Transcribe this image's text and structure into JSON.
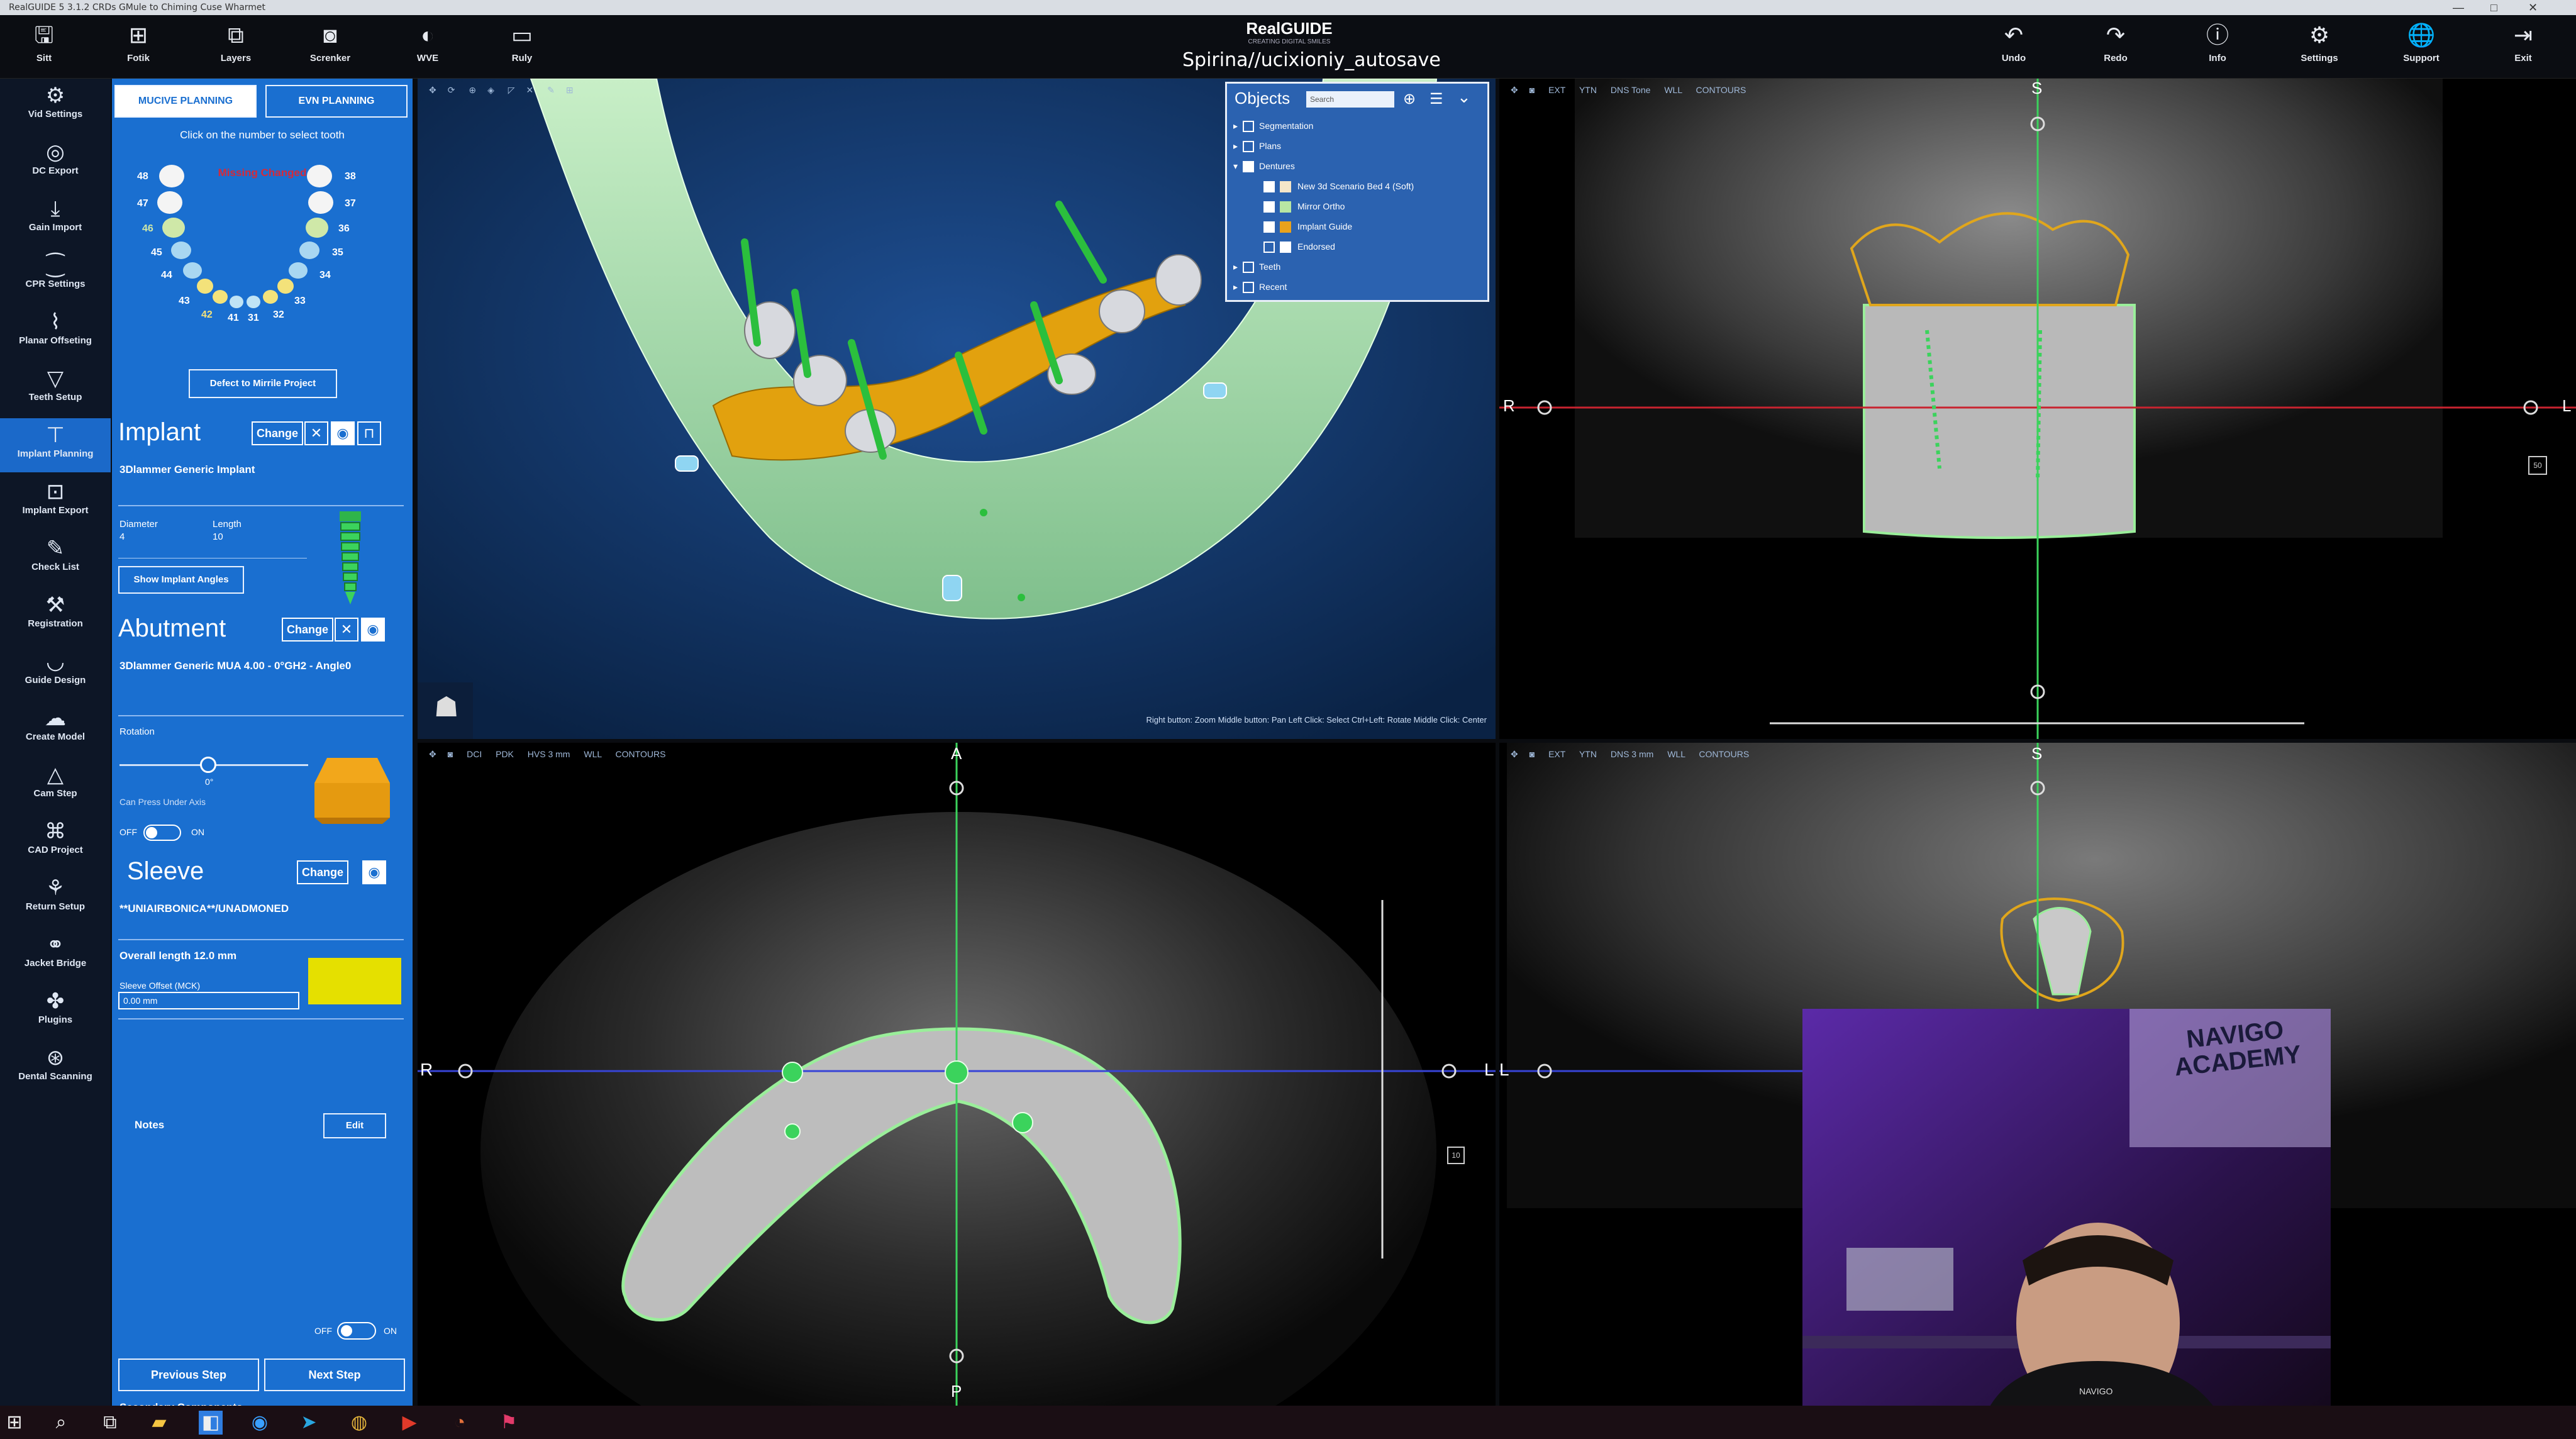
{
  "window": {
    "title": "RealGUIDE 5 3.1.2 CRDs GMule to Chiming Cuse Wharmet",
    "controls": [
      "—",
      "□",
      "✕"
    ]
  },
  "toolbar": {
    "left": [
      {
        "label": "Sitt",
        "icon": "save-icon"
      },
      {
        "label": "Fotik",
        "icon": "export-icon"
      },
      {
        "label": "Layers",
        "icon": "layers-icon"
      },
      {
        "label": "Screnker",
        "icon": "camera-icon"
      },
      {
        "label": "WVE",
        "icon": "contrast-icon"
      },
      {
        "label": "Ruly",
        "icon": "ruler-icon"
      }
    ],
    "brand": "RealGUIDE",
    "brand_sub": "CREATING DIGITAL SMILES",
    "file_name": "Spirina//ucixioniy_autosave",
    "right": [
      {
        "label": "Undo",
        "icon": "undo-icon"
      },
      {
        "label": "Redo",
        "icon": "redo-icon"
      },
      {
        "label": "Info",
        "icon": "info-icon"
      },
      {
        "label": "Settings",
        "icon": "gear-icon"
      },
      {
        "label": "Support",
        "icon": "globe-icon"
      },
      {
        "label": "Exit",
        "icon": "exit-icon"
      }
    ]
  },
  "sidebar": {
    "items": [
      {
        "label": "Vid Settings",
        "icon": "sliders-icon"
      },
      {
        "label": "DC Export",
        "icon": "target-icon"
      },
      {
        "label": "Gain Import",
        "icon": "import-icon"
      },
      {
        "label": "CPR Settings",
        "icon": "curve-icon"
      },
      {
        "label": "Planar Offseting",
        "icon": "planar-icon"
      },
      {
        "label": "Teeth Setup",
        "icon": "tooth-icon"
      },
      {
        "label": "Implant Planning",
        "icon": "implant-icon",
        "active": true
      },
      {
        "label": "Implant Export",
        "icon": "implant-export-icon"
      },
      {
        "label": "Check List",
        "icon": "checklist-icon"
      },
      {
        "label": "Registration",
        "icon": "wrench-icon"
      },
      {
        "label": "Guide Design",
        "icon": "guide-icon"
      },
      {
        "label": "Create Model",
        "icon": "model-icon"
      },
      {
        "label": "Cam Step",
        "icon": "cam-icon"
      },
      {
        "label": "CAD Project",
        "icon": "cad-icon"
      },
      {
        "label": "Return Setup",
        "icon": "return-icon"
      },
      {
        "label": "Jacket Bridge",
        "icon": "bridge-icon"
      },
      {
        "label": "Plugins",
        "icon": "puzzle-icon"
      },
      {
        "label": "Dental Scanning",
        "icon": "scan-icon"
      }
    ]
  },
  "panel": {
    "tabs": [
      "MUCIVE PLANNING",
      "EVN PLANNING"
    ],
    "arch_caption": "Click on the number to select tooth",
    "arch_warning": "Missing Changed",
    "tooth_numbers": [
      "48",
      "47",
      "46",
      "45",
      "44",
      "43",
      "42",
      "41",
      "31",
      "32",
      "33",
      "34",
      "35",
      "36",
      "37",
      "38"
    ],
    "defect_button": "Defect to Mirrile Project",
    "implant": {
      "title": "Implant",
      "change_label": "Change",
      "name": "3Dlammer Generic Implant",
      "diameter_label": "Diameter",
      "diameter_value": "4",
      "length_label": "Length",
      "length_value": "10",
      "show_angles": "Show Implant Angles"
    },
    "abutment": {
      "title": "Abutment",
      "change_label": "Change",
      "name": "3Dlammer Generic MUA 4.00 - 0°GH2 - Angle0",
      "rotation_label": "Rotation",
      "rotation_value": "0°",
      "rotate_axis_label": "Can Press Under Axis",
      "toggle_off": "OFF",
      "toggle_on": "ON"
    },
    "sleeve": {
      "title": "Sleeve",
      "change_label": "Change",
      "name": "**UNIAIRBONICA**/UNADMONED",
      "length_label": "Overall length 12.0 mm",
      "offset_label": "Sleeve Offset (MCK)",
      "offset_value": "0.00 mm",
      "notes_label": "Notes",
      "edit_label": "Edit"
    },
    "secondary_label": "Secondary Components",
    "secondary_off": "OFF",
    "secondary_on": "ON",
    "prev_button": "Previous Step",
    "next_button": "Next Step"
  },
  "view3d": {
    "objects_title": "Objects",
    "objects_search": "Search",
    "objects": [
      {
        "label": "Segmentation",
        "level": 0
      },
      {
        "label": "Plans",
        "level": 0
      },
      {
        "label": "Dentures",
        "level": 0,
        "open": true
      },
      {
        "label": "New 3d Scenario Bed 4 (Soft)",
        "level": 1,
        "color": "#f4e6c9"
      },
      {
        "label": "Mirror Ortho",
        "level": 1,
        "color": "#b8e6a3"
      },
      {
        "label": "Implant Guide",
        "level": 1,
        "color": "#e9a21c"
      },
      {
        "label": "Endorsed",
        "level": 1,
        "color": "#ffffff"
      },
      {
        "label": "Teeth",
        "level": 0
      },
      {
        "label": "Recent",
        "level": 0
      }
    ],
    "status": "Right button: Zoom   Middle button: Pan   Left Click: Select   Ctrl+Left: Rotate   Middle Click: Center"
  },
  "coronal": {
    "toolbar": [
      "EXT",
      "YTN",
      "DNS Tone",
      "WLL",
      "CONTOURS"
    ],
    "label_top": "S",
    "label_left": "R",
    "label_right": "L",
    "scale": "50"
  },
  "axial": {
    "toolbar": [
      "DCI",
      "PDK",
      "HVS 3 mm",
      "WLL",
      "CONTOURS"
    ],
    "label_top": "A",
    "label_bottom": "P",
    "label_left": "R",
    "label_right": "L",
    "scale": "10"
  },
  "sagittal": {
    "toolbar": [
      "EXT",
      "YTN",
      "DNS 3 mm",
      "WLL",
      "CONTOURS"
    ],
    "label_top": "S",
    "label_left": "L"
  },
  "webcam": {
    "sign": "NAVIGO ACADEMY",
    "shirt": "NAVIGO"
  },
  "taskbar": {
    "icons": [
      "windows-icon",
      "search-icon",
      "taskview-icon",
      "folder-icon",
      "store-icon",
      "app-icon",
      "telegram-icon",
      "chrome-icon",
      "media-icon",
      "firefox-icon",
      "flag-icon"
    ]
  }
}
